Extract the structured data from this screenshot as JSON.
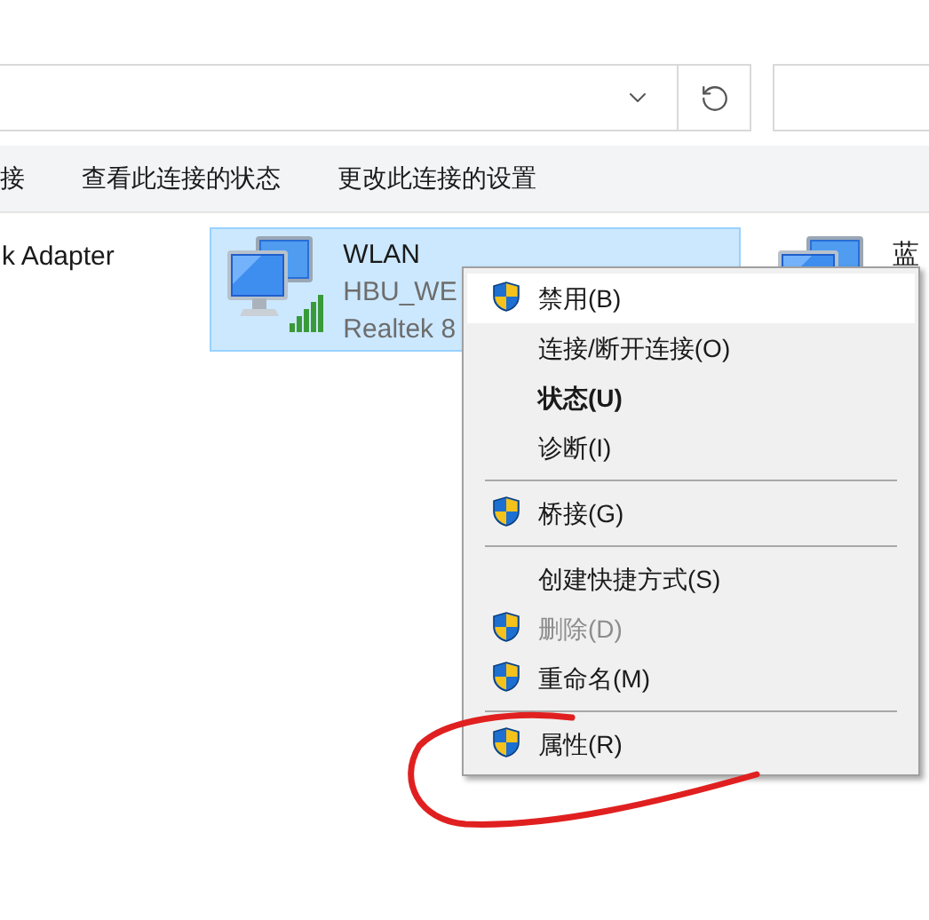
{
  "toolbar": [
    "接",
    "查看此连接的状态",
    "更改此连接的设置"
  ],
  "adapters": [
    {
      "kind": "cut",
      "name": "k Adapter",
      "selected": false
    },
    {
      "kind": "wifi",
      "name": "WLAN",
      "lines": [
        "HBU_WE",
        "Realtek 8"
      ],
      "selected": true
    },
    {
      "kind": "wired",
      "name": "蓝",
      "selected": false
    }
  ],
  "context_menu": [
    {
      "kind": "item",
      "label": "禁用(B)",
      "shield": true,
      "selected": true,
      "bold": false,
      "disabled": false
    },
    {
      "kind": "item",
      "label": "连接/断开连接(O)",
      "shield": false,
      "selected": false,
      "bold": false,
      "disabled": false
    },
    {
      "kind": "item",
      "label": "状态(U)",
      "shield": false,
      "selected": false,
      "bold": true,
      "disabled": false
    },
    {
      "kind": "item",
      "label": "诊断(I)",
      "shield": false,
      "selected": false,
      "bold": false,
      "disabled": false
    },
    {
      "kind": "separator"
    },
    {
      "kind": "item",
      "label": "桥接(G)",
      "shield": true,
      "selected": false,
      "bold": false,
      "disabled": false
    },
    {
      "kind": "separator"
    },
    {
      "kind": "item",
      "label": "创建快捷方式(S)",
      "shield": false,
      "selected": false,
      "bold": false,
      "disabled": false
    },
    {
      "kind": "item",
      "label": "删除(D)",
      "shield": true,
      "selected": false,
      "bold": false,
      "disabled": true
    },
    {
      "kind": "item",
      "label": "重命名(M)",
      "shield": true,
      "selected": false,
      "bold": false,
      "disabled": false
    },
    {
      "kind": "separator"
    },
    {
      "kind": "item",
      "label": "属性(R)",
      "shield": true,
      "selected": false,
      "bold": false,
      "disabled": false
    }
  ]
}
